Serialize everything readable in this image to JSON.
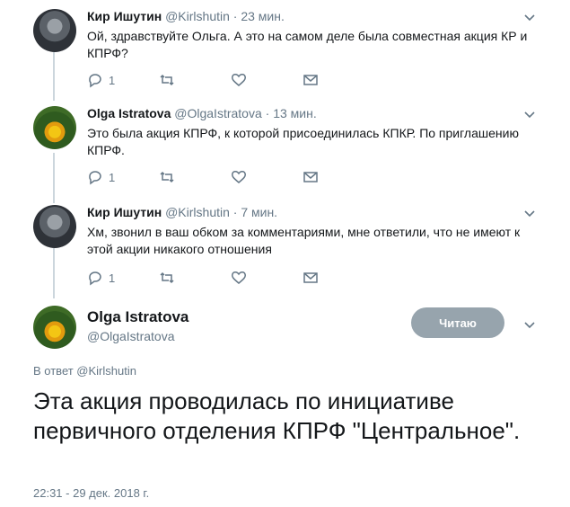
{
  "tweets": [
    {
      "name": "Кир Ишутин",
      "handle": "@Kirlshutin",
      "time": "· 23 мин.",
      "text": "Ой, здравствуйте Ольга. А это на самом деле была совместная акция КР и КПРФ?",
      "replies": "1"
    },
    {
      "name": "Olga Istratova",
      "handle": "@OlgaIstratova",
      "time": "· 13 мин.",
      "text": "Это была акция КПРФ, к которой присоединилась КПКР. По приглашению КПРФ.",
      "replies": "1"
    },
    {
      "name": "Кир Ишутин",
      "handle": "@Kirlshutin",
      "time": "· 7 мин.",
      "text": "Хм, звонил в ваш обком за комментариями, мне ответили, что не имеют к этой акции никакого отношения",
      "replies": "1"
    }
  ],
  "main_tweet": {
    "name": "Olga Istratova",
    "handle": "@OlgaIstratova",
    "follow_label": "Читаю",
    "reply_to": "В ответ @Kirlshutin",
    "text": "Эта акция проводилась по инициативе первичного отделения КПРФ \"Центральное\".",
    "timestamp": "22:31 - 29 дек. 2018 г."
  },
  "colors": {
    "muted": "#657786",
    "thread_line": "#ccd6dd",
    "follow_button": "#97a4ad"
  }
}
